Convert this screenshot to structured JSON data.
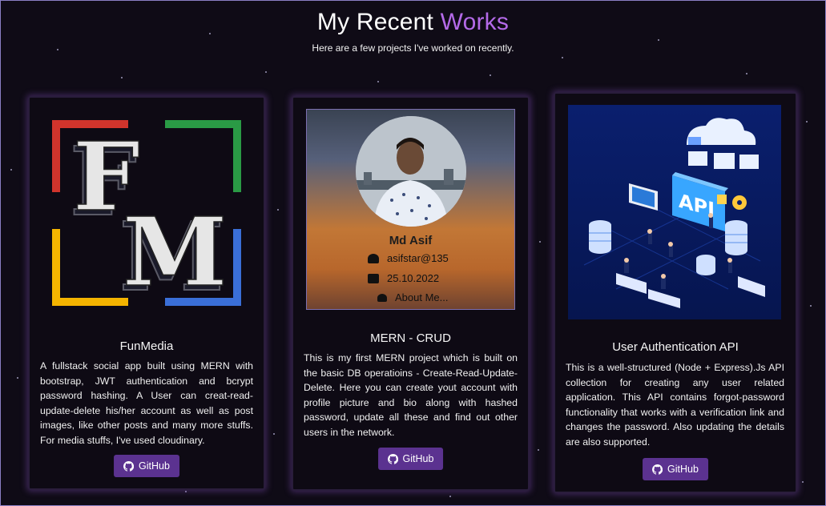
{
  "header": {
    "title_main": "My Recent ",
    "title_accent": "Works",
    "subtitle": "Here are a few projects I've worked on recently."
  },
  "colors": {
    "background": "#0f0b16",
    "accent": "#b46ae8",
    "button": "#5b3290"
  },
  "projects": [
    {
      "title": "FunMedia",
      "logo_text": "FM",
      "description": "A fullstack social app built using MERN with bootstrap, JWT authentication and bcrypt password hashing. A User can creat-read-update-delete his/her account as well as post images, like other posts and many more stuffs. For media stuffs, I've used cloudinary.",
      "button_label": "GitHub",
      "button_icon": "github-icon"
    },
    {
      "title": "MERN - CRUD",
      "preview": {
        "name": "Md Asif",
        "username": "asifstar@135",
        "date": "25.10.2022",
        "about": "About Me..."
      },
      "description": "This is my first MERN project which is built on the basic DB operatioins - Create-Read-Update-Delete. Here you can create yout account with profile picture and bio along with hashed password, update all these and find out other users in the network.",
      "button_label": "GitHub",
      "button_icon": "github-icon"
    },
    {
      "title": "User Authentication API",
      "preview_text": "API",
      "description": "This is a well-structured (Node + Express).Js API collection for creating any user related application. This API contains forgot-password functionality that works with a verification link and changes the password. Also updating the details are also supported.",
      "button_label": "GitHub",
      "button_icon": "github-icon"
    }
  ]
}
